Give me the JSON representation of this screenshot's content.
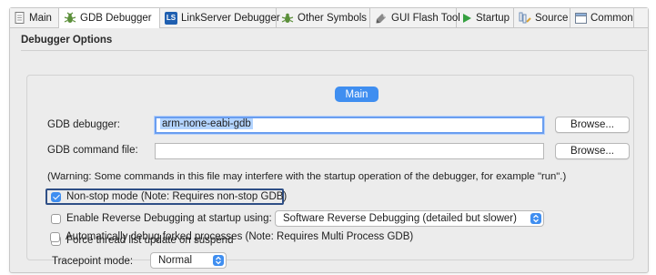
{
  "tabs": [
    {
      "label": "Main",
      "icon": "main-page-icon",
      "active": false
    },
    {
      "label": "GDB Debugger",
      "icon": "gdb-debugger-icon",
      "active": true
    },
    {
      "label": "LinkServer Debugger",
      "icon": "linkserver-ls-icon",
      "active": false
    },
    {
      "label": "Other Symbols",
      "icon": "other-symbols-icon",
      "active": false
    },
    {
      "label": "GUI Flash Tool",
      "icon": "gui-flash-tool-icon",
      "active": false
    },
    {
      "label": "Startup",
      "icon": "startup-play-icon",
      "active": false
    },
    {
      "label": "Source",
      "icon": "source-icon",
      "active": false
    },
    {
      "label": "Common",
      "icon": "common-icon",
      "active": false
    }
  ],
  "ls_badge": "LS",
  "section_title": "Debugger Options",
  "main_group": {
    "title": "Main",
    "gdb_debugger_label": "GDB debugger:",
    "gdb_debugger_value": "arm-none-eabi-gdb",
    "gdb_command_file_label": "GDB command file:",
    "gdb_command_file_value": "",
    "browse_label": "Browse...",
    "warning": "(Warning: Some commands in this file may interfere with the startup operation of the debugger, for example \"run\".)",
    "options": {
      "non_stop": {
        "label": "Non-stop mode (Note: Requires non-stop GDB)",
        "checked": true
      },
      "reverse": {
        "label": "Enable Reverse Debugging at startup using:",
        "checked": false
      },
      "force_thread": {
        "label": "Force thread list update on suspend",
        "checked": false
      },
      "auto_fork": {
        "label": "Automatically debug forked processes (Note: Requires Multi Process GDB)",
        "checked": false
      }
    },
    "reverse_method_value": "Software Reverse Debugging (detailed but slower)",
    "tracepoint_label": "Tracepoint mode:",
    "tracepoint_value": "Normal"
  },
  "colors": {
    "accent": "#3f8ef0",
    "highlight_border": "#2f4f86",
    "selection": "#b3d4ff"
  }
}
